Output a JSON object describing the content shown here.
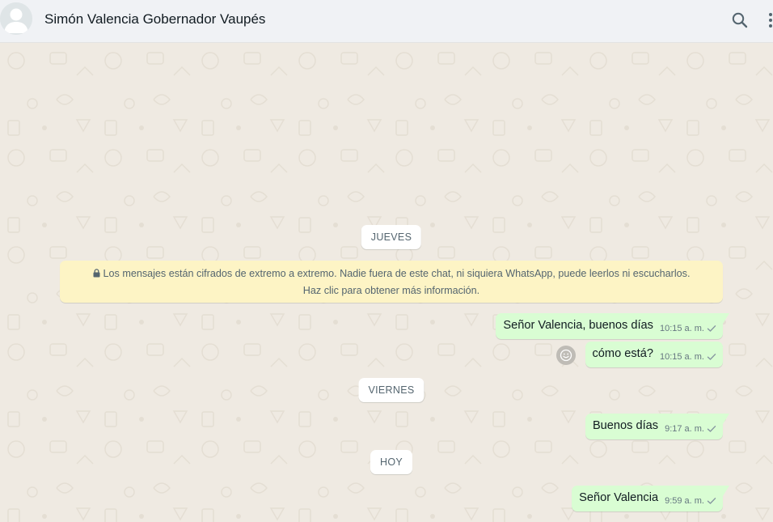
{
  "header": {
    "contact_name": "Simón Valencia Gobernador Vaupés",
    "icons": [
      "default-avatar-icon",
      "search-icon",
      "menu-icon"
    ]
  },
  "chat": {
    "date_labels": [
      "JUEVES",
      "VIERNES",
      "HOY"
    ],
    "encryption_notice": {
      "line1": "Los mensajes están cifrados de extremo a extremo. Nadie fuera de este chat, ni siquiera WhatsApp, puede leerlos ni escucharlos.",
      "line2": "Haz clic para obtener más información."
    },
    "messages": [
      {
        "text": "Señor Valencia, buenos días",
        "time": "10:15 a. m.",
        "status": "sent"
      },
      {
        "text": "cómo está?",
        "time": "10:15 a. m.",
        "status": "sent"
      },
      {
        "text": "Buenos días",
        "time": "9:17 a. m.",
        "status": "sent"
      },
      {
        "text": "Señor Valencia",
        "time": "9:59 a. m.",
        "status": "sent"
      }
    ]
  },
  "colors": {
    "header_bg": "#f0f2f5",
    "chat_bg": "#efeae2",
    "outgoing_bubble": "#d9fdd3",
    "notice_bg": "#fdf4c5",
    "check_color": "#8696a0"
  }
}
